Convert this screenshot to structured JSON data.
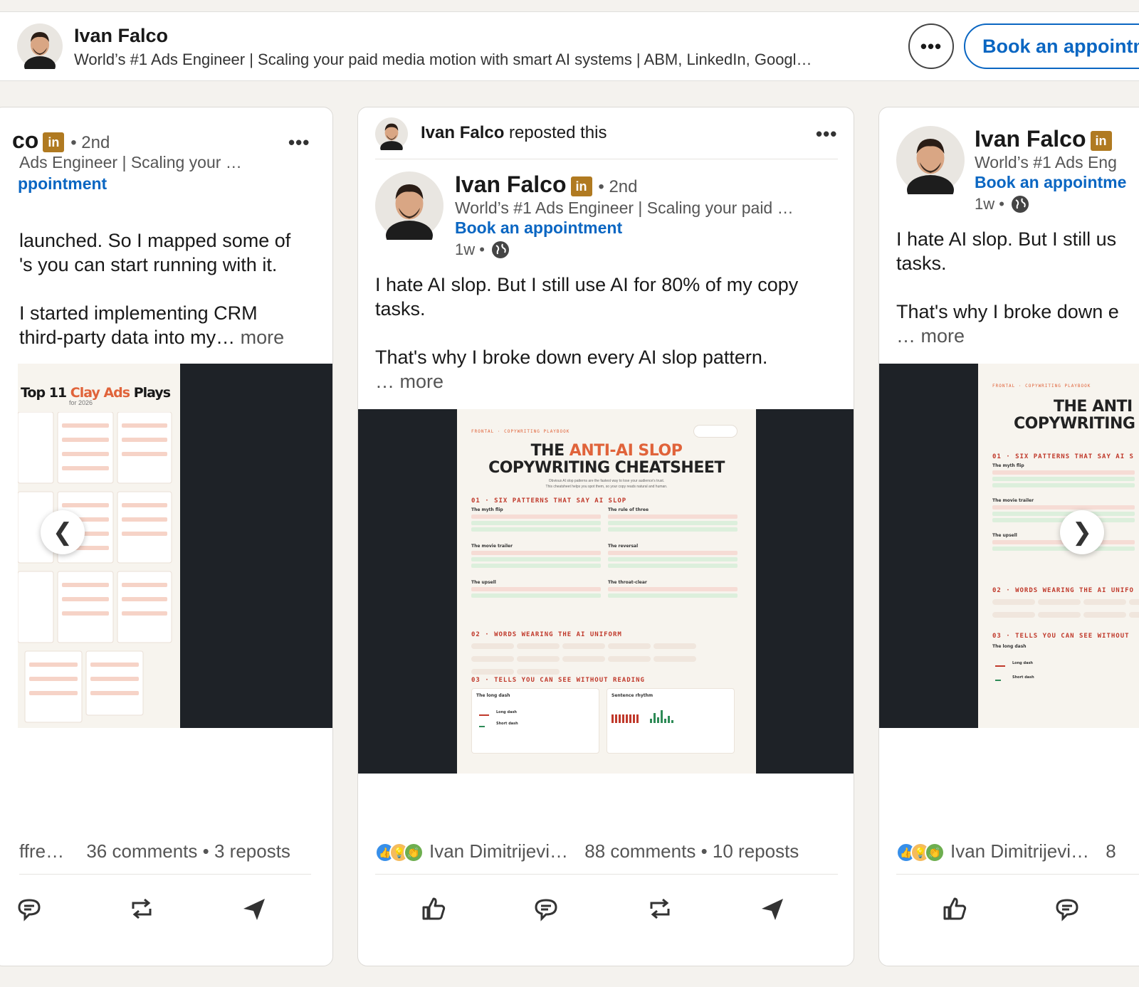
{
  "topbar": {
    "name": "Ivan Falco",
    "headline": "World’s #1 Ads Engineer | Scaling your paid media motion with smart AI systems | ABM, LinkedIn, Googl…",
    "more_icon": "ellipsis-icon",
    "book_label": "Book an appointm"
  },
  "left_card": {
    "name_fragment": "co",
    "degree": "• 2nd",
    "sub": "Ads Engineer | Scaling your …",
    "book": "ppointment",
    "body_l1": "launched. So I mapped some of",
    "body_l2": "'s you can start running with it.",
    "body_l3": "I started implementing CRM",
    "body_l4": "third-party data into my…",
    "more": "more",
    "doc_title_a": "Top 11 ",
    "doc_title_b": "Clay Ads",
    "doc_title_c": " Plays",
    "doc_subtitle": "for 2026",
    "stats_left": "ffre…",
    "comments": "36 comments",
    "reposts": "3 reposts"
  },
  "center_card": {
    "reposter_name": "Ivan Falco",
    "reposted_text": " reposted this",
    "name": "Ivan Falco",
    "degree": "• 2nd",
    "sub": "World’s #1 Ads Engineer | Scaling your paid …",
    "book": "Book an appointment",
    "time": "1w •",
    "body_p1": "I hate AI slop. But I still use AI for 80% of my copy tasks.",
    "body_p2": "That's why I broke down every AI slop pattern.",
    "more": "… more",
    "doc": {
      "brand": "FRONTAL · COPYWRITING PLAYBOOK",
      "title_a": "THE ",
      "title_b": "ANTI-AI SLOP",
      "title_c": "COPYWRITING CHEATSHEET",
      "intro_1": "Obvious AI slop patterns are the fastest way to lose your audience's trust.",
      "intro_2": "This cheatsheet helps you spot them, so your copy reads natural and human.",
      "sec1": "01 · SIX PATTERNS THAT SAY AI SLOP",
      "p1": "The myth flip",
      "p2": "The rule of three",
      "p3": "The movie trailer",
      "p4": "The reversal",
      "p5": "The upsell",
      "p6": "The throat-clear",
      "sec2": "02 · WORDS WEARING THE AI UNIFORM",
      "sec3": "03 · TELLS YOU CAN SEE WITHOUT READING",
      "t1": "The long dash",
      "t2": "Sentence rhythm",
      "t1a": "Long dash",
      "t1b": "Short dash"
    },
    "reactor": "Ivan Dimitrijevi…",
    "comments": "88 comments",
    "reposts": "10 reposts"
  },
  "right_card": {
    "name": "Ivan Falco",
    "sub": "World’s #1 Ads Eng",
    "book": "Book an appointme",
    "time": "1w •",
    "body_l1": "I hate AI slop. But I still us",
    "body_l2": "tasks.",
    "body_l3": "That's why I broke down e",
    "more": "… more",
    "doc": {
      "brand": "FRONTAL · COPYWRITING PLAYBOOK",
      "title_a": "THE ANTI",
      "title_c": "COPYWRITING",
      "sec1": "01 · SIX PATTERNS THAT SAY AI S",
      "p1": "The myth flip",
      "p2": "The movie trailer",
      "p3": "The upsell",
      "sec2": "02 · WORDS WEARING THE AI UNIFO",
      "sec3": "03 · TELLS YOU CAN SEE WITHOUT",
      "t1": "The long dash",
      "t1a": "Long dash",
      "t1b": "Short dash"
    },
    "reactor": "Ivan Dimitrijevi…",
    "stats_cut": "8"
  },
  "carousel": {
    "prev": "❮",
    "next": "❯"
  }
}
